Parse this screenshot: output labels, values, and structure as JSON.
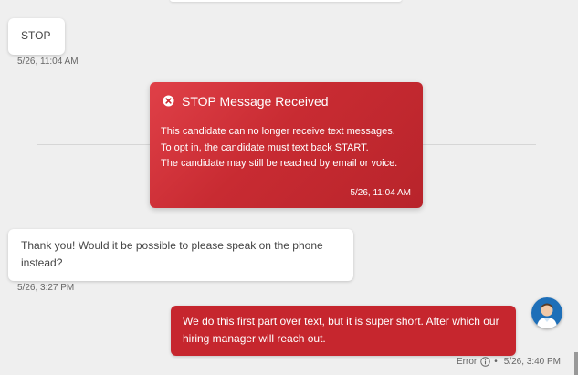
{
  "messages": [
    {
      "text": "STOP",
      "timestamp": "5/26, 11:04 AM"
    },
    {
      "text": "Thank you!  Would it be possible to please speak on the phone instead?",
      "timestamp": "5/26, 3:27 PM"
    }
  ],
  "stop_notice": {
    "title": "STOP Message Received",
    "lines": [
      "This candidate can no longer receive text messages.",
      "To opt in, the candidate must text back START.",
      "The candidate may still be reached by email or voice."
    ],
    "timestamp": "5/26, 11:04 AM"
  },
  "outgoing": {
    "text": "We do this first part over text, but it is super short. After which our hiring manager will reach out.",
    "status": "Error",
    "separator": "•",
    "timestamp": "5/26, 3:40 PM"
  },
  "colors": {
    "notice_red": "#c82b32",
    "outgoing_red": "#c6262e",
    "background": "#efefef"
  },
  "icons": {
    "notice": "close-circle-icon",
    "status": "info-icon",
    "avatar": "user-avatar"
  }
}
